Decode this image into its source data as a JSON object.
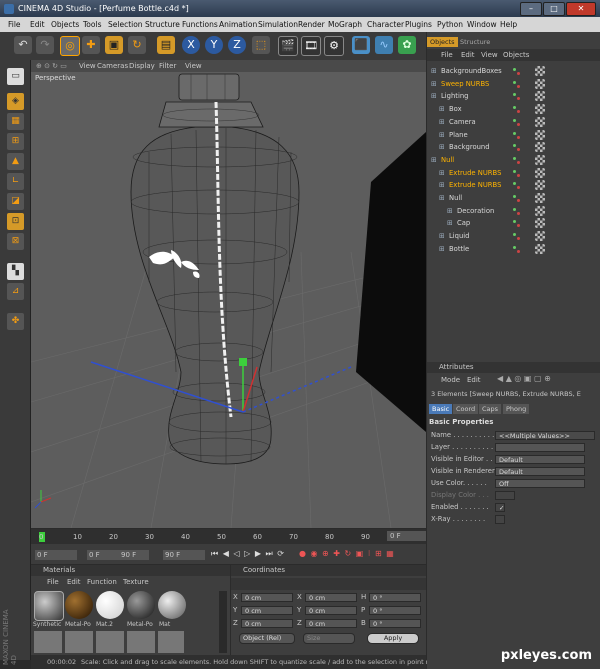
{
  "window": {
    "title": "CINEMA 4D Studio - [Perfume Bottle.c4d *]",
    "buttons": [
      "–",
      "□",
      "✕"
    ]
  },
  "menubar": [
    "File",
    "Edit",
    "Objects",
    "Tools",
    "Selection",
    "Structure",
    "Functions",
    "Animation",
    "Simulation",
    "Render",
    "MoGraph",
    "Character",
    "Plugins",
    "Python",
    "Window",
    "Help"
  ],
  "toolbar": {
    "axis_x": "X",
    "axis_y": "Y",
    "axis_z": "Z"
  },
  "viewport": {
    "menu": [
      "View",
      "Cameras",
      "Display",
      "Filter",
      "View"
    ],
    "label": "Perspective"
  },
  "timeline": {
    "ticks": [
      "0",
      "10",
      "20",
      "30",
      "40",
      "50",
      "60",
      "70",
      "80",
      "90"
    ],
    "frame_right": "0 F",
    "start": "0 F",
    "current": "0 F",
    "end_a": "90 F",
    "end_b": "90 F"
  },
  "materials": {
    "title": "Materials",
    "menu": [
      "File",
      "Edit",
      "Function",
      "Texture"
    ],
    "items": [
      "Synthetic",
      "Metal-Po",
      "Mat.2",
      "Metal-Po",
      "Mat"
    ]
  },
  "coordinates": {
    "title": "Coordinates",
    "rows": [
      {
        "a": "X",
        "av": "0 cm",
        "b": "X",
        "bv": "0 cm",
        "c": "H",
        "cv": "0 °"
      },
      {
        "a": "Y",
        "av": "0 cm",
        "b": "Y",
        "bv": "0 cm",
        "c": "P",
        "cv": "0 °"
      },
      {
        "a": "Z",
        "av": "0 cm",
        "b": "Z",
        "bv": "0 cm",
        "c": "B",
        "cv": "0 °"
      }
    ],
    "mode": "Object (Rel)",
    "size": "Size",
    "apply": "Apply"
  },
  "status": {
    "time": "00:00:02",
    "text": "Scale: Click and drag to scale elements. Hold down SHIFT to quantize scale / add to the selection in point mode"
  },
  "objects": {
    "tabs": [
      "Objects",
      "Structure"
    ],
    "menu": [
      "File",
      "Edit",
      "View",
      "Objects"
    ],
    "rows": [
      {
        "name": "BackgroundBoxes",
        "indent": 0,
        "color": "#d8d8d8"
      },
      {
        "name": "Sweep NURBS",
        "indent": 0,
        "color": "#ffb400"
      },
      {
        "name": "Lighting",
        "indent": 0,
        "color": "#d8d8d8"
      },
      {
        "name": "Box",
        "indent": 1,
        "color": "#d8d8d8"
      },
      {
        "name": "Camera",
        "indent": 1,
        "color": "#d8d8d8"
      },
      {
        "name": "Plane",
        "indent": 1,
        "color": "#d8d8d8"
      },
      {
        "name": "Background",
        "indent": 1,
        "color": "#d8d8d8"
      },
      {
        "name": "Null",
        "indent": 0,
        "color": "#ffb400"
      },
      {
        "name": "Extrude NURBS",
        "indent": 1,
        "color": "#ffb400"
      },
      {
        "name": "Extrude NURBS",
        "indent": 1,
        "color": "#ffb400"
      },
      {
        "name": "Null",
        "indent": 1,
        "color": "#d8d8d8"
      },
      {
        "name": "Decoration",
        "indent": 2,
        "color": "#d8d8d8"
      },
      {
        "name": "Cap",
        "indent": 2,
        "color": "#d8d8d8"
      },
      {
        "name": "Liquid",
        "indent": 1,
        "color": "#d8d8d8"
      },
      {
        "name": "Bottle",
        "indent": 1,
        "color": "#d8d8d8"
      }
    ]
  },
  "attributes": {
    "title": "Attributes",
    "menu": [
      "Mode",
      "Edit"
    ],
    "selection": "3 Elements [Sweep NURBS, Extrude NURBS, E",
    "tabs": [
      "Basic",
      "Coord",
      "Caps",
      "Phong"
    ],
    "section": "Basic Properties",
    "rows": [
      {
        "label": "Name . . . . . . . . . .",
        "value": "<<Multiple Values>>"
      },
      {
        "label": "Layer . . . . . . . . . .",
        "value": ""
      },
      {
        "label": "Visible in Editor . .",
        "value": "Default"
      },
      {
        "label": "Visible in Renderer",
        "value": "Default"
      },
      {
        "label": "Use Color. . . . . .",
        "value": "Off"
      },
      {
        "label": "Display Color . . .",
        "value": ""
      },
      {
        "label": "Enabled . . . . . . .",
        "value": "✓"
      },
      {
        "label": "X-Ray . . . . . . . .",
        "value": ""
      }
    ]
  },
  "brand": {
    "maxon": "MAXON CINEMA 4D",
    "watermark": "pxleyes.com"
  }
}
